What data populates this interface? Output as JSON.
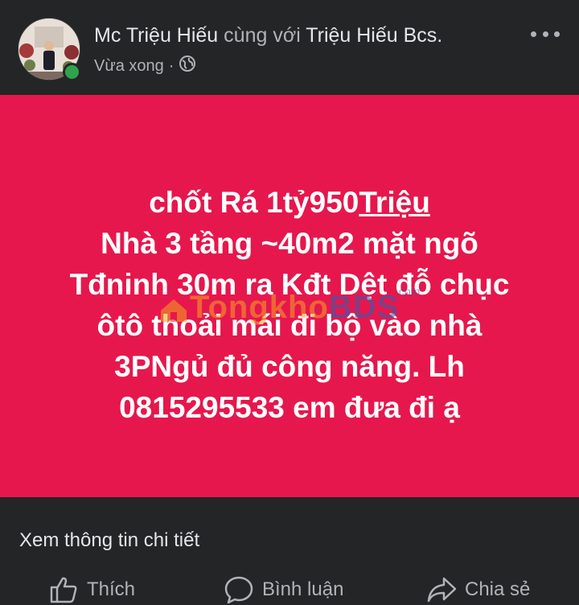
{
  "post": {
    "author": "Mc Triệu Hiếu",
    "connector": "cùng với",
    "tagged": "Triệu Hiếu Bcs.",
    "time": "Vừa xong",
    "separator": "·",
    "privacy_icon": "globe-icon",
    "more_icon": "more-horizontal-icon"
  },
  "image": {
    "background": "#e6174c",
    "lines": [
      {
        "pre": "chốt Rá 1tỷ950",
        "underlined": "Triệu"
      },
      {
        "pre": "Nhà 3 tầng ~40m2 mặt ngõ",
        "underlined": ""
      },
      {
        "pre": "Tđninh 30m ra Kđt Dệt đỗ chục",
        "underlined": ""
      },
      {
        "pre": "ôtô thoải mái đi bộ vào nhà",
        "underlined": ""
      },
      {
        "pre": "3PNgủ đủ công năng. Lh",
        "underlined": ""
      },
      {
        "pre": "0815295533 em đưa đi ạ",
        "underlined": ""
      }
    ],
    "watermark": {
      "part1": "Tongkho",
      "part2": "BDS",
      "suffix": ".com"
    }
  },
  "details_link": "Xem thông tin chi tiết",
  "actions": {
    "like": "Thích",
    "comment": "Bình luận",
    "share": "Chia sẻ"
  }
}
